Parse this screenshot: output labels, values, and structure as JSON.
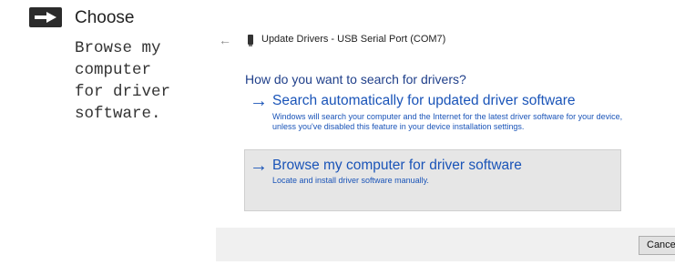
{
  "instruction": {
    "icon": "right-arrow-icon",
    "title": "Choose",
    "body_lines": [
      "Browse my",
      "computer",
      "for driver",
      "software."
    ]
  },
  "dialog": {
    "back_icon": "back-arrow-icon",
    "device_icon": "usb-device-icon",
    "title": "Update Drivers - USB Serial Port (COM7)",
    "question": "How do you want to search for drivers?",
    "options": [
      {
        "icon": "right-arrow-icon",
        "title": "Search automatically for updated driver software",
        "description": "Windows will search your computer and the Internet for the latest driver software for your device, unless you've disabled this feature in your device installation settings."
      },
      {
        "icon": "right-arrow-icon",
        "title": "Browse my computer for driver software",
        "description": "Locate and install driver software manually.",
        "highlighted": true
      }
    ],
    "cancel_label": "Cancel",
    "colors": {
      "link_blue": "#1a54b8",
      "heading_blue": "#1f3f8a",
      "highlight_bg": "#e6e6e6",
      "footer_bg": "#f0f0f0"
    }
  }
}
